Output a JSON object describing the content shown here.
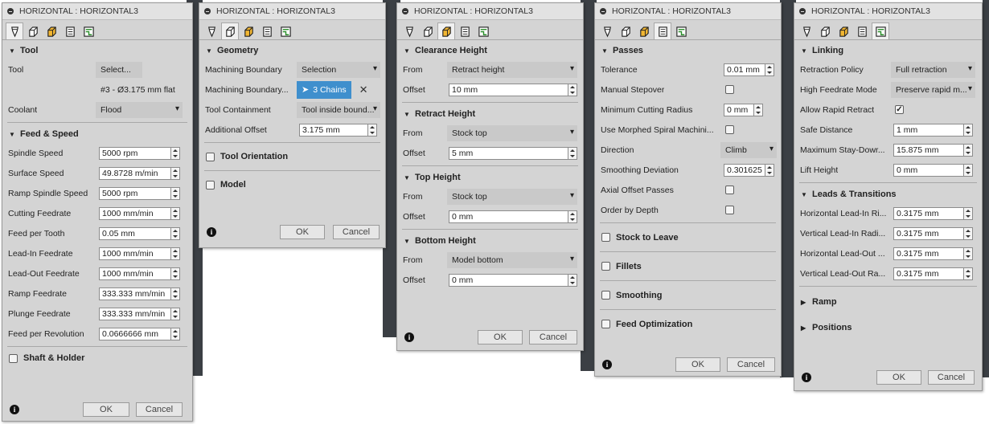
{
  "window_title": "HORIZONTAL : HORIZONTAL3",
  "footer": {
    "ok": "OK",
    "cancel": "Cancel"
  },
  "tabs": [
    "tool-tab",
    "geometry-tab",
    "heights-tab",
    "passes-tab",
    "linking-tab"
  ],
  "panel1": {
    "tool_section": "Tool",
    "tool_label": "Tool",
    "tool_select": "Select...",
    "tool_desc": "#3 - Ø3.175 mm flat",
    "coolant_label": "Coolant",
    "coolant_value": "Flood",
    "feed_section": "Feed & Speed",
    "spindle_speed_label": "Spindle Speed",
    "spindle_speed": "5000 rpm",
    "surface_speed_label": "Surface Speed",
    "surface_speed": "49.8728 m/min",
    "ramp_spindle_speed_label": "Ramp Spindle Speed",
    "ramp_spindle_speed": "5000 rpm",
    "cutting_feedrate_label": "Cutting Feedrate",
    "cutting_feedrate": "1000 mm/min",
    "feed_per_tooth_label": "Feed per Tooth",
    "feed_per_tooth": "0.05 mm",
    "lead_in_feedrate_label": "Lead-In Feedrate",
    "lead_in_feedrate": "1000 mm/min",
    "lead_out_feedrate_label": "Lead-Out Feedrate",
    "lead_out_feedrate": "1000 mm/min",
    "ramp_feedrate_label": "Ramp Feedrate",
    "ramp_feedrate": "333.333 mm/min",
    "plunge_feedrate_label": "Plunge Feedrate",
    "plunge_feedrate": "333.333 mm/min",
    "feed_per_rev_label": "Feed per Revolution",
    "feed_per_rev": "0.0666666 mm",
    "shaft_section": "Shaft & Holder"
  },
  "panel2": {
    "geometry_section": "Geometry",
    "machining_boundary_label": "Machining Boundary",
    "machining_boundary": "Selection",
    "machining_boundary_sel_label": "Machining Boundary...",
    "chains": "3 Chains",
    "tool_containment_label": "Tool Containment",
    "tool_containment": "Tool inside bound...",
    "additional_offset_label": "Additional Offset",
    "additional_offset": "3.175 mm",
    "tool_orientation_section": "Tool Orientation",
    "model_section": "Model"
  },
  "panel3": {
    "clearance_section": "Clearance Height",
    "clearance_from_label": "From",
    "clearance_from": "Retract height",
    "clearance_offset_label": "Offset",
    "clearance_offset": "10 mm",
    "retract_section": "Retract Height",
    "retract_from_label": "From",
    "retract_from": "Stock top",
    "retract_offset_label": "Offset",
    "retract_offset": "5 mm",
    "top_section": "Top Height",
    "top_from_label": "From",
    "top_from": "Stock top",
    "top_offset_label": "Offset",
    "top_offset": "0 mm",
    "bottom_section": "Bottom Height",
    "bottom_from_label": "From",
    "bottom_from": "Model bottom",
    "bottom_offset_label": "Offset",
    "bottom_offset": "0 mm"
  },
  "panel4": {
    "passes_section": "Passes",
    "tolerance_label": "Tolerance",
    "tolerance": "0.01 mm",
    "manual_stepover_label": "Manual Stepover",
    "min_cut_radius_label": "Minimum Cutting Radius",
    "min_cut_radius": "0 mm",
    "morphed_label": "Use Morphed Spiral Machini...",
    "direction_label": "Direction",
    "direction": "Climb",
    "smoothing_dev_label": "Smoothing Deviation",
    "smoothing_dev": "0.301625 m",
    "axial_offset_label": "Axial Offset Passes",
    "order_by_depth_label": "Order by Depth",
    "stock_to_leave_section": "Stock to Leave",
    "fillets_section": "Fillets",
    "smoothing_section": "Smoothing",
    "feed_opt_section": "Feed Optimization"
  },
  "panel5": {
    "linking_section": "Linking",
    "retraction_policy_label": "Retraction Policy",
    "retraction_policy": "Full retraction",
    "high_feedrate_mode_label": "High Feedrate Mode",
    "high_feedrate_mode": "Preserve rapid m...",
    "allow_rapid_label": "Allow Rapid Retract",
    "safe_distance_label": "Safe Distance",
    "safe_distance": "1 mm",
    "max_stay_down_label": "Maximum Stay-Dowr...",
    "max_stay_down": "15.875 mm",
    "lift_height_label": "Lift Height",
    "lift_height": "0 mm",
    "leads_section": "Leads & Transitions",
    "h_lead_in_label": "Horizontal Lead-In Ri...",
    "h_lead_in": "0.3175 mm",
    "v_lead_in_label": "Vertical Lead-In Radi...",
    "v_lead_in": "0.3175 mm",
    "h_lead_out_label": "Horizontal Lead-Out ...",
    "h_lead_out": "0.3175 mm",
    "v_lead_out_label": "Vertical Lead-Out Ra...",
    "v_lead_out": "0.3175 mm",
    "ramp_section": "Ramp",
    "positions_section": "Positions"
  }
}
